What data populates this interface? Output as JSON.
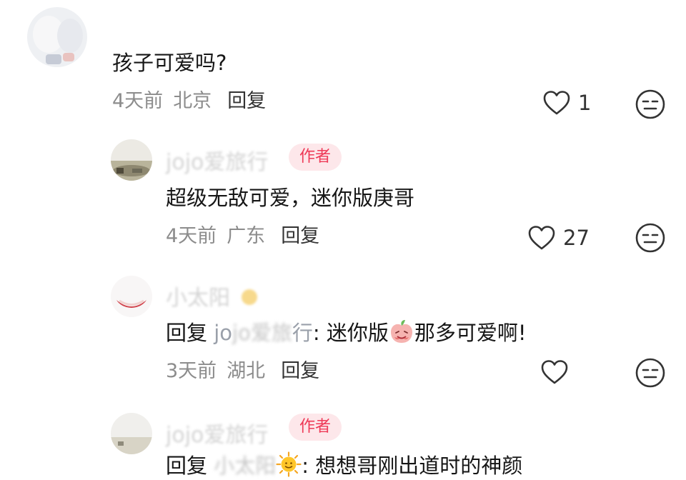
{
  "comments": [
    {
      "username": "",
      "text": "孩子可爱吗?",
      "time": "4天前",
      "location": "北京",
      "reply_label": "回复",
      "likes": "1"
    },
    {
      "username": "jojo爱旅行",
      "badge": "作者",
      "text": "超级无敌可爱，迷你版庚哥",
      "time": "4天前",
      "location": "广东",
      "reply_label": "回复",
      "likes": "27"
    },
    {
      "username": "小太阳",
      "text_prefix": "回复 ",
      "text_mention_visible": "jo",
      "text_mention_blur": "jo爱旅",
      "text_mention_tail": "行",
      "text_body_1": ": 迷你版",
      "text_body_2": "那多可爱啊!",
      "time": "3天前",
      "location": "湖北",
      "reply_label": "回复",
      "likes": ""
    },
    {
      "username": "jojo爱旅行",
      "badge": "作者",
      "text_prefix": "回复 ",
      "text_mention_blur": "小太阳",
      "text_body": ": 想想哥刚出道时的神颜"
    }
  ],
  "icons": {
    "like": "heart-outline-icon",
    "dislike": "meh-face-icon",
    "sun_emoji": "sun-emoji",
    "peach_emoji": "peach-emoji"
  },
  "colors": {
    "author_badge_bg": "#fde7ea",
    "author_badge_text": "#ee3a57",
    "meta_text": "#8c8c8c"
  }
}
